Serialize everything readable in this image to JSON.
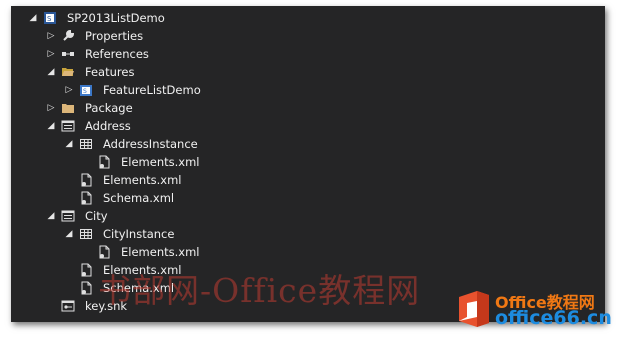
{
  "tree": {
    "items": [
      {
        "label": "SP2013ListDemo",
        "icon": "sharepoint-project-icon",
        "expander": "expanded"
      },
      {
        "label": "Properties",
        "icon": "wrench-icon",
        "expander": "collapsed"
      },
      {
        "label": "References",
        "icon": "references-icon",
        "expander": "collapsed"
      },
      {
        "label": "Features",
        "icon": "folder-open-icon",
        "expander": "expanded"
      },
      {
        "label": "FeatureListDemo",
        "icon": "feature-icon",
        "expander": "collapsed"
      },
      {
        "label": "Package",
        "icon": "folder-icon",
        "expander": "collapsed"
      },
      {
        "label": "Address",
        "icon": "list-definition-icon",
        "expander": "expanded"
      },
      {
        "label": "AddressInstance",
        "icon": "table-icon",
        "expander": "expanded"
      },
      {
        "label": "Elements.xml",
        "icon": "xml-file-icon",
        "expander": "none"
      },
      {
        "label": "Elements.xml",
        "icon": "xml-file-icon",
        "expander": "none"
      },
      {
        "label": "Schema.xml",
        "icon": "xml-file-icon",
        "expander": "none"
      },
      {
        "label": "City",
        "icon": "list-definition-icon",
        "expander": "expanded"
      },
      {
        "label": "CityInstance",
        "icon": "table-icon",
        "expander": "expanded"
      },
      {
        "label": "Elements.xml",
        "icon": "xml-file-icon",
        "expander": "none"
      },
      {
        "label": "Elements.xml",
        "icon": "xml-file-icon",
        "expander": "none"
      },
      {
        "label": "Schema.xml",
        "icon": "xml-file-icon",
        "expander": "none"
      },
      {
        "label": "key.snk",
        "icon": "key-file-icon",
        "expander": "none"
      }
    ]
  },
  "watermark": {
    "text": "书部网-Office教程网"
  },
  "logo": {
    "line1": "Office教程网",
    "line2": "office66.cn"
  },
  "colors": {
    "panel_bg": "#252526",
    "text": "#f1f1f1",
    "watermark": "#be3c32",
    "logo_orange": "#f07814",
    "logo_blue": "#1d8ce0"
  }
}
